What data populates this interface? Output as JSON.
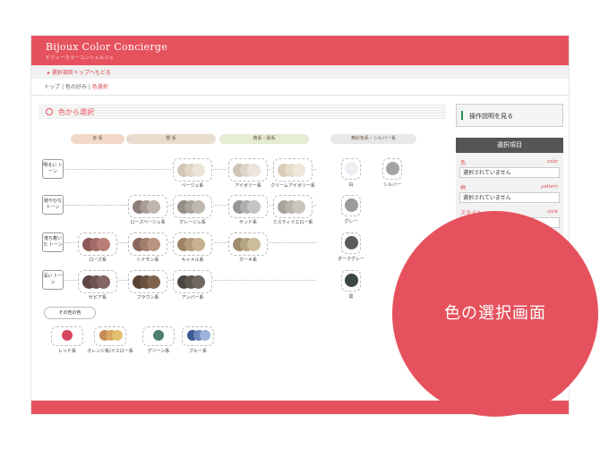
{
  "app": {
    "title": "Bijoux Color Concierge",
    "subtitle": "ビジューカラーコンシェルジュ"
  },
  "nav": {
    "back_link": "▸ 選択項目トップへもどる",
    "breadcrumb": [
      "トップ",
      "色の好み",
      "色選択"
    ],
    "separator": "|"
  },
  "section": {
    "title": "色から選択"
  },
  "categories": [
    "赤 系",
    "橙 系",
    "黄系・緑系",
    "無彩色系・シルバー系"
  ],
  "category_colors": [
    "#f2d9c7",
    "#e9ddd0",
    "#e4ecd2",
    "#e8e8e8"
  ],
  "rows": [
    "明るい\nトーン",
    "穏やかな\nトーン",
    "落ち着いた\nトーン",
    "深い\nトーン"
  ],
  "swatches": [
    {
      "label": "ベージュ系",
      "colors": [
        "#d4c7b8",
        "#e0d5c7",
        "#ece4d8"
      ]
    },
    {
      "label": "アイボリー系",
      "colors": [
        "#cfc6b5",
        "#ddd6c8",
        "#ebe5db"
      ]
    },
    {
      "label": "クリームアイボリー系",
      "colors": [
        "#d9cdb6",
        "#e6dcc9",
        "#efe8da"
      ]
    },
    {
      "label": "ローズベージュ系",
      "colors": [
        "#8e7e7a",
        "#a99b96",
        "#c0b4ae"
      ]
    },
    {
      "label": "グレージュ系",
      "colors": [
        "#958e87",
        "#aaa39c",
        "#bfb8b1"
      ]
    },
    {
      "label": "サンド系",
      "colors": [
        "#979797",
        "#aeaeae",
        "#c4c4c4"
      ]
    },
    {
      "label": "ミスティイエロー系",
      "colors": [
        "#a7a39a",
        "#b8b4ab",
        "#c9c5bc"
      ]
    },
    {
      "label": "ローズ系",
      "colors": [
        "#8c5a58",
        "#a16b66",
        "#b87e76"
      ]
    },
    {
      "label": "シナモン系",
      "colors": [
        "#8a6a5c",
        "#a27e6c",
        "#b99481"
      ]
    },
    {
      "label": "キャメル系",
      "colors": [
        "#9d8465",
        "#b39a79",
        "#c9b190"
      ]
    },
    {
      "label": "カーキ系",
      "colors": [
        "#a08f6f",
        "#b7a684",
        "#cdbd99"
      ]
    },
    {
      "label": "セピア系",
      "colors": [
        "#5c4545",
        "#6f5454",
        "#836565"
      ]
    },
    {
      "label": "ブラウン系",
      "colors": [
        "#574334",
        "#6a5240",
        "#7e634e"
      ]
    },
    {
      "label": "アンバー系",
      "colors": [
        "#4a4540",
        "#5b554f",
        "#6d675f"
      ]
    }
  ],
  "neutrals": [
    {
      "label": "白",
      "color": "#eceef2"
    },
    {
      "label": "シルバー",
      "color": "#a3a3a3"
    },
    {
      "label": "グレー",
      "color": "#9b9b9b"
    },
    {
      "label": "ダークグレー",
      "color": "#5b5b5b"
    },
    {
      "label": "黒",
      "color": "#3c4744"
    }
  ],
  "other": {
    "label": "その他の色",
    "items": [
      {
        "label": "レッド系",
        "colors": [
          "#d6465e"
        ]
      },
      {
        "label": "オレンジ系/イエロー系",
        "colors": [
          "#c98a55",
          "#d9a563",
          "#e3c06f"
        ]
      },
      {
        "label": "グリーン系",
        "colors": [
          "#4d7d6e"
        ]
      },
      {
        "label": "ブルー系",
        "colors": [
          "#3d5a93",
          "#6d87bb",
          "#9eb3da"
        ]
      }
    ]
  },
  "sidebar": {
    "guide_button": "操作説明を見る",
    "selected_header": "選択項目",
    "fields": [
      {
        "label": "色",
        "en": "color",
        "value": "選択されていません"
      },
      {
        "label": "柄",
        "en": "pattern",
        "value": "選択されていません"
      },
      {
        "label": "スタイル",
        "en": "style",
        "value": ""
      }
    ]
  },
  "callout": "色の選択画面",
  "colors": {
    "accent": "#e5525d"
  }
}
